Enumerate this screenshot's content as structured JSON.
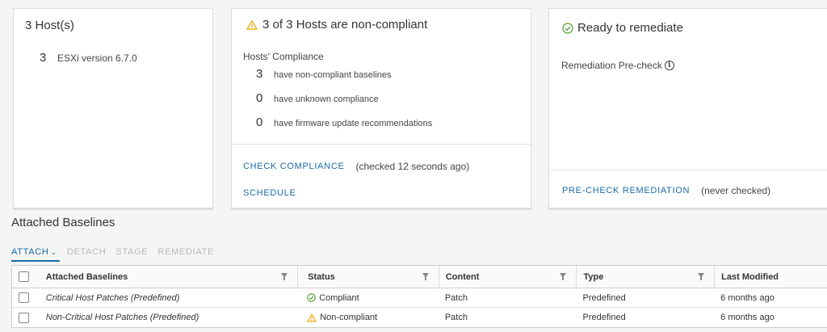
{
  "hosts_card": {
    "title": "3 Host(s)",
    "count": "3",
    "version": "ESXi version 6.7.0"
  },
  "compliance_card": {
    "title": "3 of 3 Hosts are non-compliant",
    "section_label": "Hosts' Compliance",
    "rows": [
      {
        "count": "3",
        "label": "have non-compliant baselines"
      },
      {
        "count": "0",
        "label": "have unknown compliance"
      },
      {
        "count": "0",
        "label": "have firmware update recommendations"
      }
    ],
    "check_link": "CHECK COMPLIANCE",
    "checked_note": "(checked 12 seconds ago)",
    "schedule_link": "SCHEDULE"
  },
  "remediate_card": {
    "title": "Ready to remediate",
    "precheck_label": "Remediation Pre-check",
    "info_glyph": "i",
    "precheck_link": "PRE-CHECK REMEDIATION",
    "precheck_note": "(never checked)"
  },
  "baselines": {
    "title": "Attached Baselines",
    "toolbar": {
      "attach": "ATTACH",
      "detach": "DETACH",
      "stage": "STAGE",
      "remediate": "REMEDIATE"
    },
    "columns": {
      "name": "Attached Baselines",
      "status": "Status",
      "content": "Content",
      "type": "Type",
      "modified": "Last Modified"
    },
    "rows": [
      {
        "name": "Critical Host Patches (Predefined)",
        "status": "Compliant",
        "content": "Patch",
        "type": "Predefined",
        "modified": "6 months ago"
      },
      {
        "name": "Non-Critical Host Patches (Predefined)",
        "status": "Non-compliant",
        "content": "Patch",
        "type": "Predefined",
        "modified": "6 months ago"
      }
    ]
  },
  "colors": {
    "accent": "#1a6aa8",
    "ok": "#4c9a2a",
    "warning": "#e6a700"
  },
  "icons": {
    "compliance_title": "warning-triangle-icon",
    "remediate_title": "check-circle-icon",
    "status_compliant": "check-circle-icon",
    "status_noncompliant": "warning-triangle-icon"
  }
}
